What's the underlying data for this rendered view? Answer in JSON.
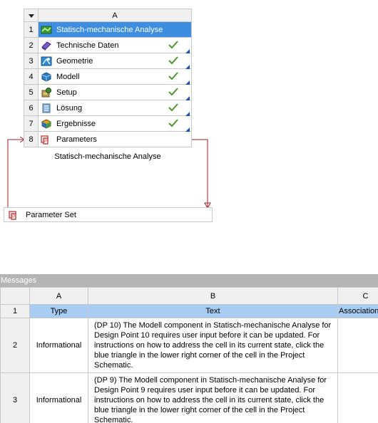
{
  "system": {
    "column_header": "A",
    "rows": [
      {
        "num": "1",
        "label": "Statisch-mechanische Analyse",
        "icon": "static-structural-icon",
        "status": "",
        "selected": true
      },
      {
        "num": "2",
        "label": "Technische Daten",
        "icon": "engineering-data-icon",
        "status": "up-to-date",
        "selected": false
      },
      {
        "num": "3",
        "label": "Geometrie",
        "icon": "geometry-icon",
        "status": "up-to-date",
        "selected": false
      },
      {
        "num": "4",
        "label": "Modell",
        "icon": "model-icon",
        "status": "up-to-date",
        "selected": false
      },
      {
        "num": "5",
        "label": "Setup",
        "icon": "setup-icon",
        "status": "up-to-date",
        "selected": false
      },
      {
        "num": "6",
        "label": "Lösung",
        "icon": "solution-icon",
        "status": "up-to-date",
        "selected": false
      },
      {
        "num": "7",
        "label": "Ergebnisse",
        "icon": "results-icon",
        "status": "up-to-date",
        "selected": false
      },
      {
        "num": "8",
        "label": "Parameters",
        "icon": "parameters-icon",
        "status": "",
        "selected": false
      }
    ],
    "caption": "Statisch-mechanische Analyse"
  },
  "parameter_set": {
    "label": "Parameter Set",
    "icon": "parameters-icon"
  },
  "messages": {
    "title": "Messages",
    "columns": [
      "A",
      "B",
      "C"
    ],
    "header_row": {
      "num": "1",
      "type": "Type",
      "text": "Text",
      "association": "Association"
    },
    "rows": [
      {
        "num": "2",
        "type": "Informational",
        "text": "(DP 10) The Modell component in Statisch-mechanische Analyse for Design Point 10 requires user input before it can be updated. For instructions on how to address the cell in its current state, click the blue triangle in the lower right corner of the cell in the Project Schematic.",
        "association": ""
      },
      {
        "num": "3",
        "type": "Informational",
        "text": "(DP 9) The Modell component in Statisch-mechanische Analyse for Design Point 9 requires user input before it can be updated. For instructions on how to address the cell in its current state, click the blue triangle in the lower right corner of the cell in the Project Schematic.",
        "association": ""
      }
    ]
  },
  "colors": {
    "selected_row": "#3d8ee0",
    "check_green": "#4f9a2c",
    "corner_triangle": "#1f4fb5",
    "link_line": "#a02020",
    "messages_title_bg": "#b4b4b4",
    "header_highlight": "#a9cdf2"
  }
}
